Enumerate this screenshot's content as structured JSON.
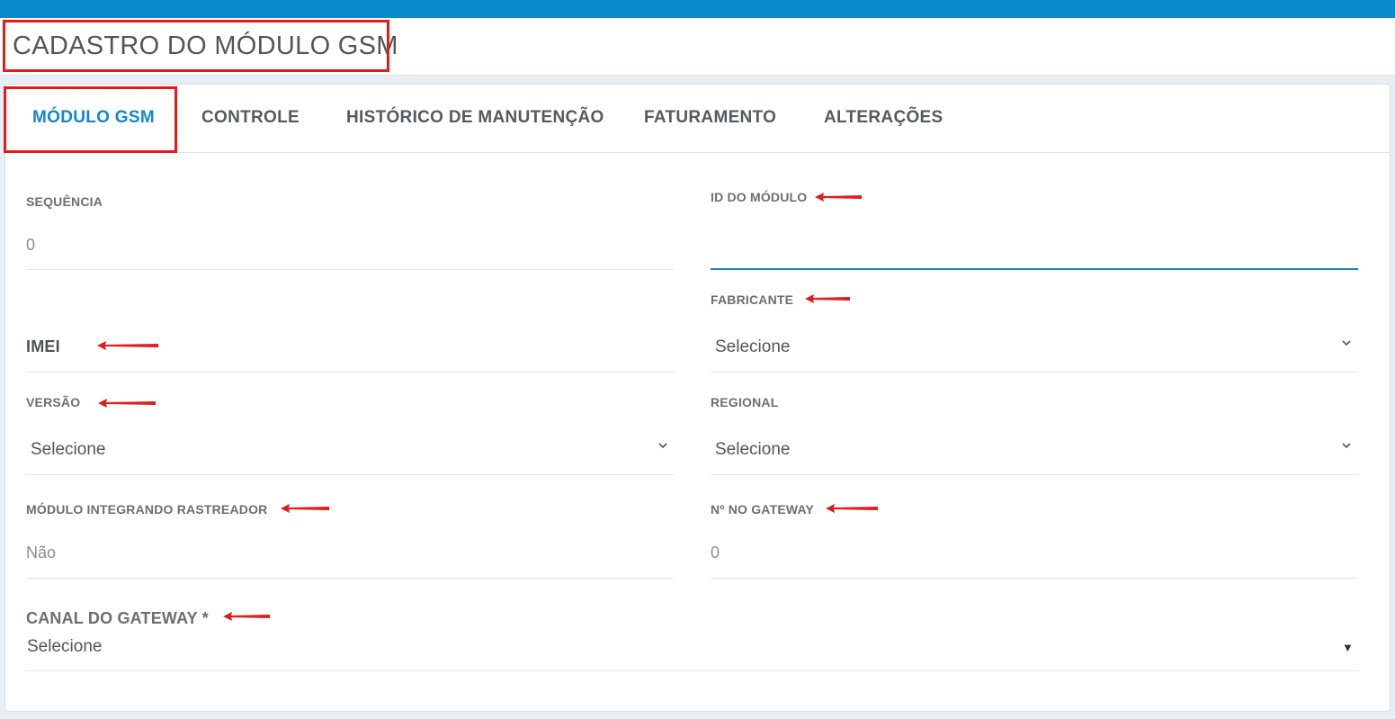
{
  "header": {
    "title": "CADASTRO DO MÓDULO GSM"
  },
  "tabs": [
    {
      "label": "MÓDULO GSM",
      "active": true
    },
    {
      "label": "CONTROLE"
    },
    {
      "label": "HISTÓRICO DE MANUTENÇÃO"
    },
    {
      "label": "FATURAMENTO"
    },
    {
      "label": "ALTERAÇÕES"
    }
  ],
  "form": {
    "sequencia": {
      "label": "SEQUÊNCIA",
      "value": "0"
    },
    "id_modulo": {
      "label": "ID DO MÓDULO",
      "value": ""
    },
    "fabricante": {
      "label": "FABRICANTE",
      "value": "Selecione"
    },
    "imei": {
      "label": "IMEI"
    },
    "versao": {
      "label": "VERSÃO",
      "value": "Selecione"
    },
    "regional": {
      "label": "REGIONAL",
      "value": "Selecione"
    },
    "modulo_integrando": {
      "label": "MÓDULO INTEGRANDO RASTREADOR",
      "value": "Não"
    },
    "no_gateway": {
      "label": "Nº NO GATEWAY",
      "value": "0"
    },
    "canal_gateway": {
      "label": "CANAL DO GATEWAY *",
      "value": "Selecione"
    }
  },
  "colors": {
    "accent": "#1587c8",
    "topbar": "#0a89cc",
    "annotation": "#e21b1b"
  },
  "icons": {
    "chevron": "chevron-down-icon",
    "arrow": "red-arrow-annotation",
    "triangle": "caret-down-icon"
  }
}
